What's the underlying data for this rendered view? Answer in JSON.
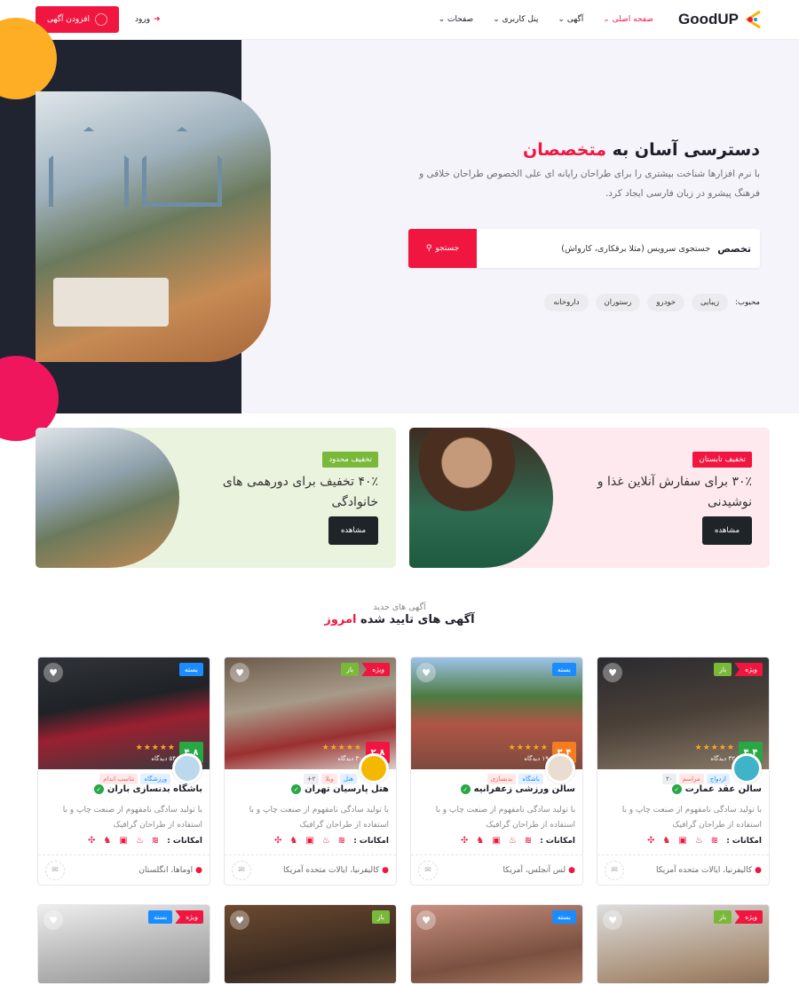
{
  "header": {
    "logo": "GoodUP",
    "nav": [
      "صفحه اصلی",
      "آگهی",
      "پنل کاربری",
      "صفحات"
    ],
    "login": "ورود",
    "add_listing": "افزودن آگهی"
  },
  "hero": {
    "title_prefix": "دسترسی آسان به",
    "title_highlight": "متخصصان",
    "description": "با نرم افزارها شناخت بیشتری را برای طراحان رایانه ای علی الخصوص طراحان خلاقی و فرهنگ پیشرو در زبان فارسی ایجاد کرد.",
    "search_label": "تخصص",
    "search_placeholder": "جستجوی سرویس (مثلا برقکاری، کارواش)",
    "search_button": "جستجو",
    "popular_label": "محبوب:",
    "popular": [
      "زیبایی",
      "خودرو",
      "رستوران",
      "داروخانه"
    ]
  },
  "promos": [
    {
      "tag": "تخفیف تابستان",
      "title": "۳۰٪ برای سفارش آنلاین غذا و نوشیدنی",
      "button": "مشاهده"
    },
    {
      "tag": "تخفیف محدود",
      "title": "۴۰٪ تخفیف برای دورهمی های خانوادگی",
      "button": "مشاهده"
    }
  ],
  "section": {
    "subtitle": "آگهی های جدید",
    "title": "آگهی های تایید شده",
    "title_highlight": "امروز"
  },
  "listings": [
    {
      "title": "سالن عقد عمارت",
      "status": "باز",
      "featured": "ویژه",
      "rating": "۴.۴",
      "rating_color": "#28a745",
      "views": "۳۲ دیدگاه",
      "tags": [
        "ازدواج",
        "مراسم",
        "۲۰"
      ],
      "description": "با تولید سادگی نامفهوم از صنعت چاپ و با استفاده از طراحان گرافیک",
      "facilities_label": "امکانات :",
      "location": "کالیفرنیا، ایالات متحده آمریکا"
    },
    {
      "title": "سالن ورزشی زعفرانیه",
      "status": "بسته",
      "featured": null,
      "rating": "۳.۴",
      "rating_color": "#f57c1f",
      "views": "۱۹ دیدگاه",
      "tags": [
        "باشگاه",
        "بدنسازی"
      ],
      "description": "با تولید سادگی نامفهوم از صنعت چاپ و با استفاده از طراحان گرافیک",
      "facilities_label": "امکانات :",
      "location": "لس آنجلس، آمریکا"
    },
    {
      "title": "هتل پارسیان تهران",
      "status": "باز",
      "featured": "ویژه",
      "rating": "۲.۸",
      "rating_color": "#f0163f",
      "views": "۳۰ دیدگاه",
      "tags": [
        "هتل",
        "ویلا",
        "۲+"
      ],
      "description": "با تولید سادگی نامفهوم از صنعت چاپ و با استفاده از طراحان گرافیک",
      "facilities_label": "امکانات :",
      "location": "کالیفرنیا، ایالات متحده آمریکا"
    },
    {
      "title": "باشگاه بدنسازی باران",
      "status": "بسته",
      "featured": null,
      "rating": "۴.۸",
      "rating_color": "#28a745",
      "views": "۵۴ دیدگاه",
      "tags": [
        "ورزشگاه",
        "تناسب اندام"
      ],
      "description": "با تولید سادگی نامفهوم از صنعت چاپ و با استفاده از طراحان گرافیک",
      "facilities_label": "امکانات :",
      "location": "اوماها، انگلستان"
    }
  ],
  "listings_row2": [
    {
      "status": "باز",
      "featured": "ویژه"
    },
    {
      "status": "بسته",
      "featured": null
    },
    {
      "status": "باز",
      "featured": null
    },
    {
      "status": "بسته",
      "featured": "ویژه"
    }
  ]
}
